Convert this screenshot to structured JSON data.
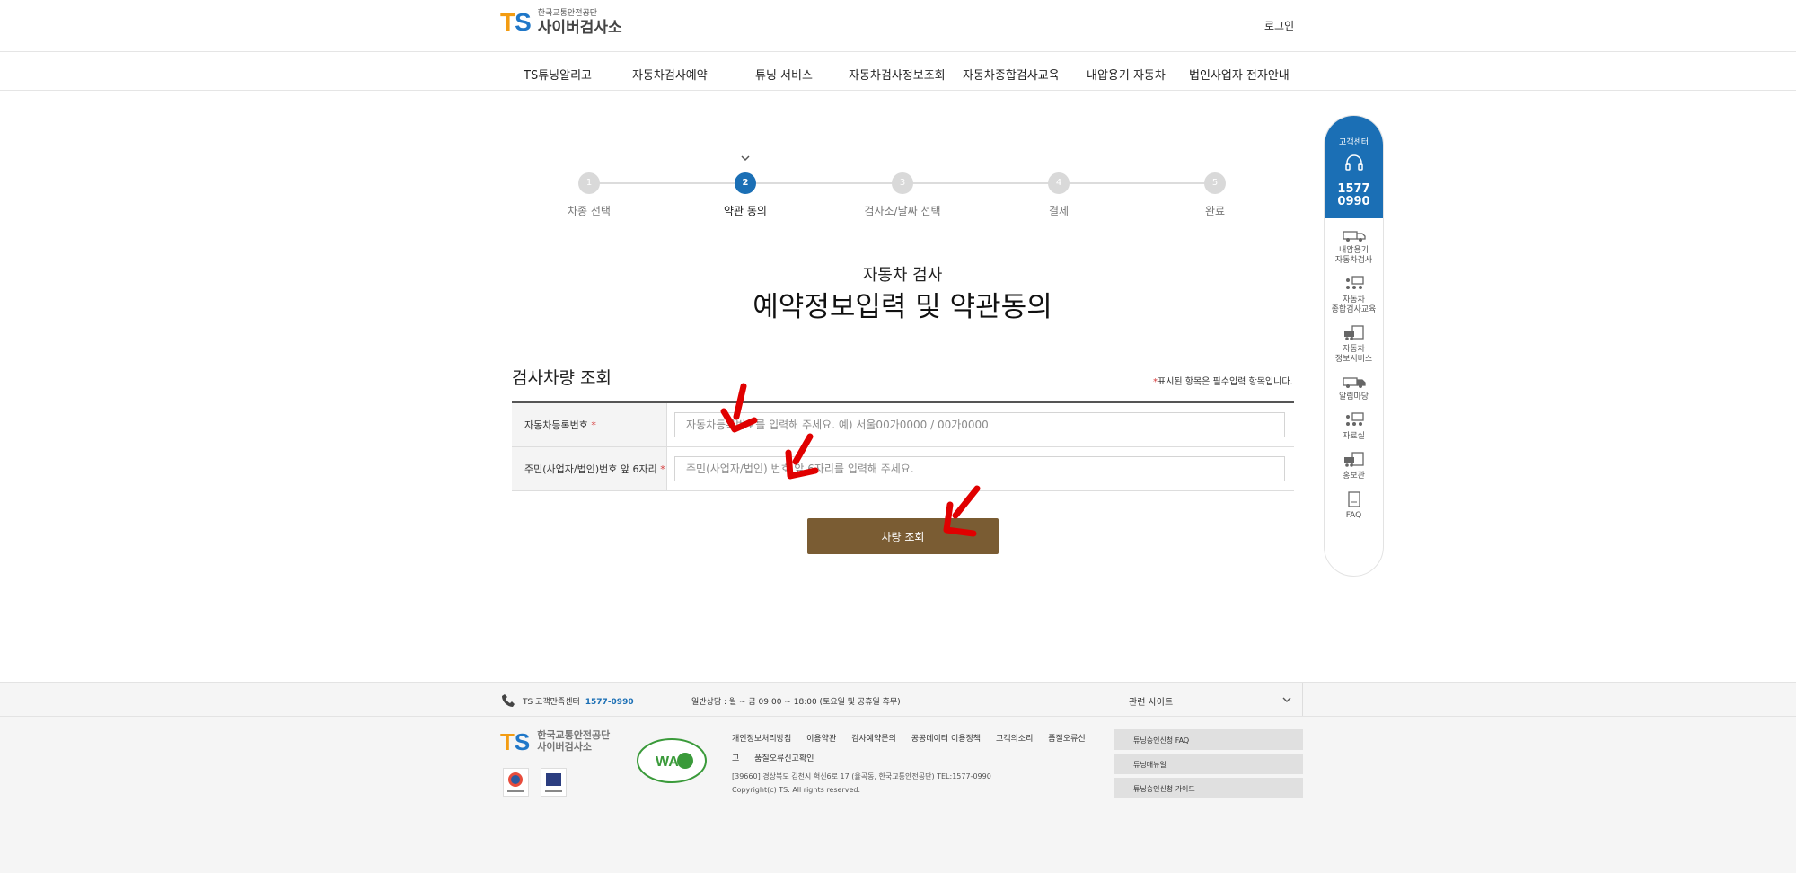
{
  "header": {
    "logo_ts": "TS",
    "logo_small": "한국교통안전공단",
    "logo_big": "사이버검사소",
    "login": "로그인"
  },
  "gnb": [
    "TS튜닝알리고",
    "자동차검사예약",
    "튜닝 서비스",
    "자동차검사정보조회",
    "자동차종합검사교육",
    "내압용기 자동차",
    "법인사업자 전자안내"
  ],
  "steps": [
    {
      "num": "1",
      "label": "차종 선택",
      "active": false
    },
    {
      "num": "2",
      "label": "약관 동의",
      "active": true
    },
    {
      "num": "3",
      "label": "검사소/날짜 선택",
      "active": false
    },
    {
      "num": "4",
      "label": "결제",
      "active": false
    },
    {
      "num": "5",
      "label": "완료",
      "active": false
    }
  ],
  "page": {
    "subtitle": "자동차 검사",
    "title": "예약정보입력 및 약관동의"
  },
  "form": {
    "section_title": "검사차량 조회",
    "required_star": "*",
    "required_note": "표시된 항목은 필수입력 항목입니다.",
    "rows": [
      {
        "label": "자동차등록번호",
        "placeholder": "자동차등록번호를 입력해 주세요. 예) 서울00가0000 / 00가0000"
      },
      {
        "label": "주민(사업자/법인)번호 앞 6자리",
        "placeholder": "주민(사업자/법인) 번호 앞 6자리를 입력해 주세요."
      }
    ],
    "search_button": "차량 조회"
  },
  "quick_menu": {
    "cs_label": "고객센터",
    "cs_num1": "1577",
    "cs_num2": "0990",
    "items": [
      {
        "line1": "내압용기",
        "line2": "자동차검사",
        "icon": "truck-icon"
      },
      {
        "line1": "자동차",
        "line2": "종합검사교육",
        "icon": "education-icon"
      },
      {
        "line1": "자동차",
        "line2": "정보서비스",
        "icon": "info-service-icon"
      },
      {
        "line1": "알림마당",
        "line2": "",
        "icon": "notice-icon"
      },
      {
        "line1": "자료실",
        "line2": "",
        "icon": "archive-icon"
      },
      {
        "line1": "홍보관",
        "line2": "",
        "icon": "promotion-icon"
      },
      {
        "line1": "FAQ",
        "line2": "",
        "icon": "faq-icon"
      }
    ]
  },
  "footer_bar": {
    "cs_label": "TS 고객만족센터",
    "cs_number": "1577-0990",
    "hours": "일반상담 : 월 ~ 금 09:00 ~ 18:00 (토요일 및 공휴일 휴무)",
    "related": "관련 사이트"
  },
  "footer": {
    "logo_line1": "한국교통안전공단",
    "logo_line2": "사이버검사소",
    "links": [
      "개인정보처리방침",
      "이용약관",
      "검사예약문의",
      "공공데이터 이용정책",
      "고객의소리",
      "품질오류신고",
      "품질오류신고확인"
    ],
    "address": "[39660] 경상북도 김천시 혁신6로 17 (율곡동, 한국교통안전공단) TEL:1577-0990",
    "copyright": "Copyright(c) TS. All rights reserved.",
    "side_links": [
      "튜닝승인신청 FAQ",
      "튜닝매뉴얼",
      "튜닝승인신청 가이드"
    ],
    "wa_mark": "WA"
  },
  "colors": {
    "primary_blue": "#1b6fb5",
    "button_brown": "#7a5c33",
    "required_red": "#d63b3b",
    "arrow_red": "#e00000"
  }
}
